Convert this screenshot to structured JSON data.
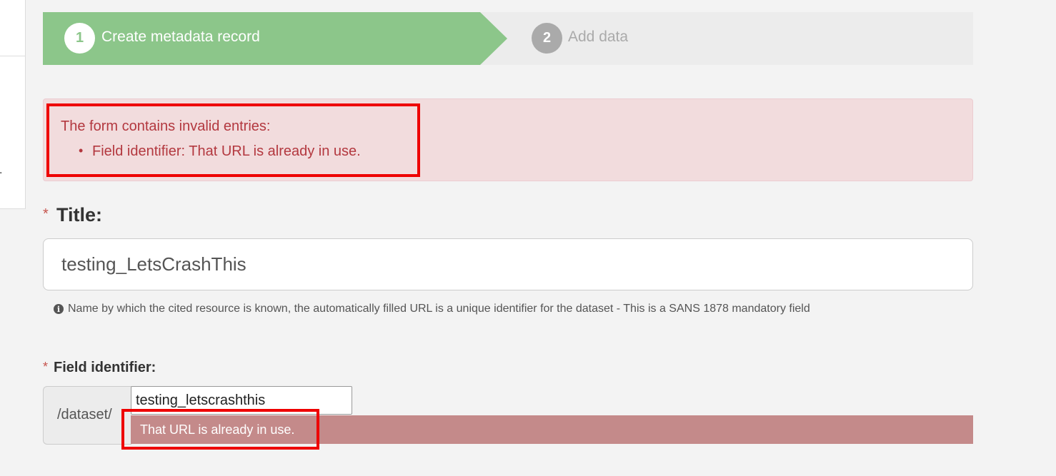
{
  "stages": {
    "step1": {
      "number": "1",
      "label": "Create metadata record"
    },
    "step2": {
      "number": "2",
      "label": "Add data"
    }
  },
  "alert": {
    "title": "The form contains invalid entries:",
    "items": [
      "Field identifier: That URL is already in use."
    ]
  },
  "title_field": {
    "required_mark": "*",
    "label": "Title:",
    "value": "testing_LetsCrashThis",
    "info_text": "Name by which the cited resource is known, the automatically filled URL is a unique identifier for the dataset - This is a SANS 1878 mandatory field"
  },
  "identifier_field": {
    "required_mark": "*",
    "label": "Field identifier:",
    "prefix": "/dataset/",
    "value": "testing_letscrashthis",
    "error": "That URL is already in use."
  },
  "left_panel": {
    "trailing_char": "."
  },
  "colors": {
    "stage_active": "#8cc68a",
    "stage_inactive": "#ececec",
    "alert_bg": "#f2dcdd",
    "alert_text": "#b3383f",
    "error_bar": "#c48a8a",
    "highlight": "#ee0000"
  },
  "icons": {
    "info": "info-circle-icon"
  }
}
